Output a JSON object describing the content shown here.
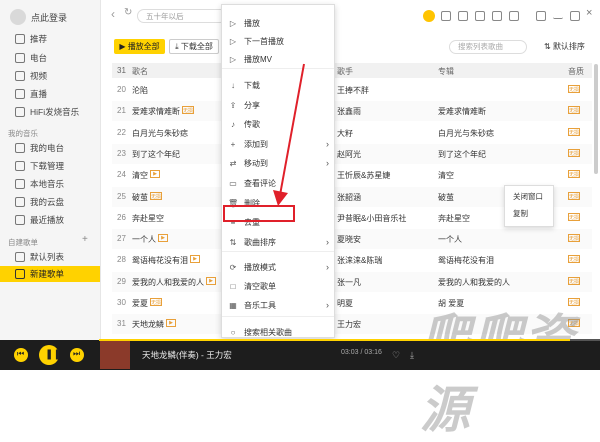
{
  "sidebar": {
    "login": "点此登录",
    "items": [
      {
        "label": "推荐",
        "icon": "recommend-icon"
      },
      {
        "label": "电台",
        "icon": "radio-icon"
      },
      {
        "label": "视频",
        "icon": "video-icon"
      },
      {
        "label": "直播",
        "icon": "live-icon"
      },
      {
        "label": "HiFi发烧音乐",
        "icon": "hifi-icon"
      }
    ],
    "my_music_title": "我的音乐",
    "my_music": [
      {
        "label": "我的电台",
        "icon": "my-radio-icon"
      },
      {
        "label": "下载管理",
        "icon": "download-icon"
      },
      {
        "label": "本地音乐",
        "icon": "local-music-icon"
      },
      {
        "label": "我的云盘",
        "icon": "cloud-icon"
      },
      {
        "label": "最近播放",
        "icon": "recent-icon"
      }
    ],
    "playlists_title": "自建歌单",
    "add": "+",
    "playlists": [
      {
        "label": "默认列表",
        "icon": "list-icon"
      },
      {
        "label": "新建歌单",
        "icon": "list-icon",
        "active": true
      }
    ]
  },
  "header": {
    "back": "‹",
    "refresh": "↻",
    "search_placeholder": "五十年以后",
    "vip_color": "#ffc400"
  },
  "actions": {
    "play_all": "播放全部",
    "download_all": "下载全部",
    "search_placeholder": "搜索列表歌曲",
    "default_sort": "默认排序"
  },
  "table": {
    "count": "31",
    "col_title": "歌名",
    "col_artist": "歌手",
    "col_album": "专辑",
    "col_quality": "音质",
    "rows": [
      {
        "num": "20",
        "title": "沦陷",
        "artist": "王捧不胖",
        "album": "",
        "tag": "无损"
      },
      {
        "num": "21",
        "title": "爱难求情难断",
        "artist": "张鑫雨",
        "album": "爱难求情难断",
        "tag": "无损",
        "badge": "无损"
      },
      {
        "num": "22",
        "title": "白月光与朱砂痣",
        "artist": "大籽",
        "album": "白月光与朱砂痣",
        "tag": "无损"
      },
      {
        "num": "23",
        "title": "到了这个年纪",
        "artist": "赵阿光",
        "album": "到了这个年纪",
        "tag": "无损"
      },
      {
        "num": "24",
        "title": "清空",
        "artist": "王忻辰&苏星婕",
        "album": "清空",
        "tag": "无损",
        "mv": true
      },
      {
        "num": "25",
        "title": "破茧",
        "artist": "张韶涵",
        "album": "破茧",
        "tag": "无损",
        "badge": "无损"
      },
      {
        "num": "26",
        "title": "奔赴星空",
        "artist": "尹昔眠&小田音乐社",
        "album": "奔赴星空",
        "tag": "无损"
      },
      {
        "num": "27",
        "title": "一个人",
        "artist": "夏晓安",
        "album": "一个人",
        "tag": "无损",
        "mv": true
      },
      {
        "num": "28",
        "title": "鸳语梅花没有泪",
        "artist": "张涞涞&陈瑞",
        "album": "鸳语梅花没有泪",
        "tag": "无损",
        "mv": true
      },
      {
        "num": "29",
        "title": "爱我的人和我爱的人",
        "artist": "张一凡",
        "album": "爱我的人和我爱的人",
        "tag": "无损",
        "mv": true
      },
      {
        "num": "30",
        "title": "爱夏",
        "artist": "明夏",
        "album": "胡 爱夏",
        "tag": "无损",
        "badge": "无损"
      },
      {
        "num": "31",
        "title": "天地龙鳞",
        "artist": "王力宏",
        "album": "",
        "tag": "无损",
        "mv": true
      }
    ]
  },
  "context_menu": {
    "items": [
      {
        "label": "播放",
        "icon": "▷"
      },
      {
        "label": "下一首播放",
        "icon": "▷"
      },
      {
        "label": "播放MV",
        "icon": "▷"
      },
      {
        "label": "下载",
        "icon": "↓"
      },
      {
        "label": "分享",
        "icon": "⇪"
      },
      {
        "label": "传歌",
        "icon": "♪"
      },
      {
        "label": "添加到",
        "icon": "+",
        "sub": true
      },
      {
        "label": "移动到",
        "icon": "⇄",
        "sub": true
      },
      {
        "label": "查看评论",
        "icon": "▭"
      },
      {
        "label": "删除",
        "icon": "🗑"
      },
      {
        "label": "去重",
        "icon": "≡"
      },
      {
        "label": "歌曲排序",
        "icon": "⇅",
        "sub": true
      },
      {
        "label": "播放模式",
        "icon": "⟳",
        "sub": true
      },
      {
        "label": "清空歌单",
        "icon": "□"
      },
      {
        "label": "音乐工具",
        "icon": "▦",
        "sub": true
      },
      {
        "label": "搜索相关歌曲",
        "icon": "○"
      }
    ],
    "arrow": "›"
  },
  "small_menu": {
    "items": [
      "关闭窗口",
      "复制"
    ]
  },
  "player": {
    "song": "天地龙鳞(伴奏) - 王力宏",
    "time": "03:03 / 03:16",
    "progress": 0.94,
    "accent": "#ffd200"
  },
  "watermark": "爬爬资源"
}
